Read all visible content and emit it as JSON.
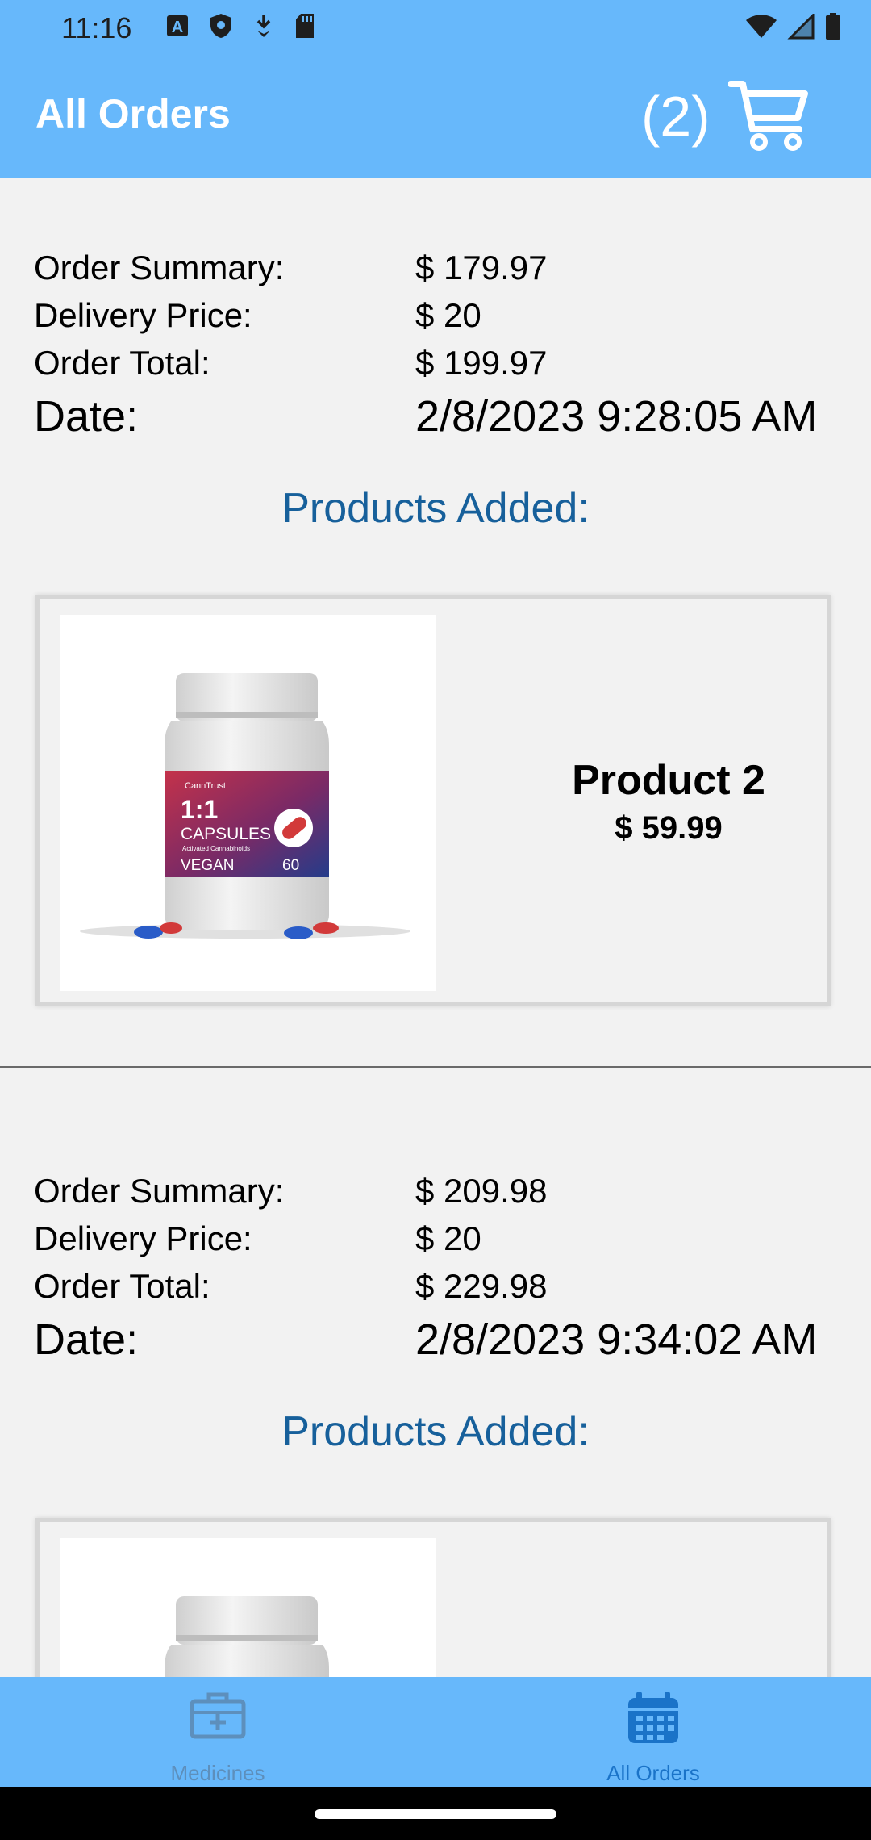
{
  "status_bar": {
    "time": "11:16",
    "icons": [
      "font-icon",
      "shield-icon",
      "download-icon",
      "sd-card-icon"
    ],
    "right_icons": [
      "wifi-icon",
      "signal-icon",
      "battery-icon"
    ]
  },
  "header": {
    "title": "All Orders",
    "cart_count": "(2)",
    "cart_icon": "shopping-cart-icon",
    "background": "#67b8fb"
  },
  "orders": [
    {
      "summary_label": "Order Summary:",
      "summary_value": "$ 179.97",
      "delivery_label": "Delivery Price:",
      "delivery_value": "$ 20",
      "total_label": "Order Total:",
      "total_value": "$ 199.97",
      "date_label": "Date:",
      "date_value": "2/8/2023 9:28:05 AM",
      "products_heading": "Products Added:",
      "products": [
        {
          "name": "Product 2",
          "price": "$ 59.99",
          "image_label": {
            "brand": "CannTrust",
            "headline": "1:1",
            "type": "CAPSULES",
            "sub": "Activated Cannabinoids",
            "diet": "VEGAN",
            "count": "60"
          }
        }
      ]
    },
    {
      "summary_label": "Order Summary:",
      "summary_value": "$ 209.98",
      "delivery_label": "Delivery Price:",
      "delivery_value": "$ 20",
      "total_label": "Order Total:",
      "total_value": "$ 229.98",
      "date_label": "Date:",
      "date_value": "2/8/2023 9:34:02 AM",
      "products_heading": "Products Added:"
    }
  ],
  "bottom_nav": [
    {
      "label": "Medicines",
      "icon": "medical-kit-icon",
      "active": false,
      "color": "#5d8fbc"
    },
    {
      "label": "All Orders",
      "icon": "calendar-icon",
      "active": true,
      "color": "#1a73c8"
    }
  ]
}
